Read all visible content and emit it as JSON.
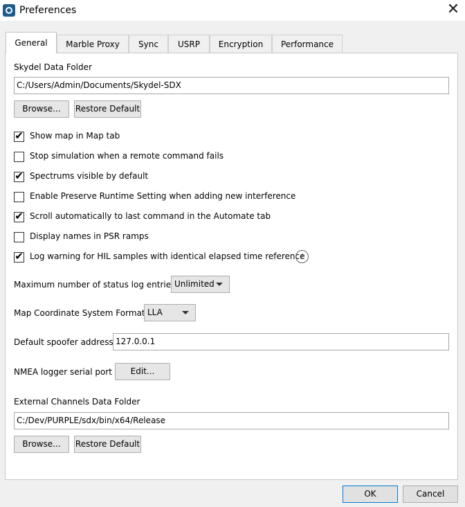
{
  "window": {
    "title": "Preferences",
    "close_symbol": "✕"
  },
  "tabs": [
    {
      "label": "General",
      "active": true
    },
    {
      "label": "Marble Proxy",
      "active": false
    },
    {
      "label": "Sync",
      "active": false
    },
    {
      "label": "USRP",
      "active": false
    },
    {
      "label": "Encryption",
      "active": false
    },
    {
      "label": "Performance",
      "active": false
    }
  ],
  "data_folder": {
    "label": "Skydel Data Folder",
    "value": "C:/Users/Admin/Documents/Skydel-SDX",
    "browse_label": "Browse...",
    "restore_label": "Restore Default"
  },
  "checkboxes": [
    {
      "label": "Show map in Map tab",
      "checked": true,
      "mark": "✔"
    },
    {
      "label": "Stop simulation when a remote command fails",
      "checked": false,
      "mark": ""
    },
    {
      "label": "Spectrums visible by default",
      "checked": true,
      "mark": "✔"
    },
    {
      "label": "Enable Preserve Runtime Setting when adding new interference",
      "checked": false,
      "mark": ""
    },
    {
      "label": "Scroll automatically to last command in the Automate tab",
      "checked": true,
      "mark": "✔"
    },
    {
      "label": "Display names in PSR ramps",
      "checked": false,
      "mark": ""
    },
    {
      "label": "Log warning for HIL samples with identical elapsed time reference",
      "checked": true,
      "mark": "✔"
    }
  ],
  "info_symbol": "i",
  "max_log": {
    "label": "Maximum number of status log entries",
    "value": "Unlimited"
  },
  "coord_format": {
    "label": "Map Coordinate System Format",
    "value": "LLA"
  },
  "spoofer": {
    "label": "Default spoofer address",
    "value": "127.0.0.1"
  },
  "nmea": {
    "label": "NMEA logger serial port",
    "edit_label": "Edit..."
  },
  "ext_folder": {
    "label": "External Channels Data Folder",
    "value": "C:/Dev/PURPLE/sdx/bin/x64/Release",
    "browse_label": "Browse...",
    "restore_label": "Restore Default"
  },
  "footer": {
    "ok_label": "OK",
    "cancel_label": "Cancel"
  },
  "colors": {
    "accent": "#0078d7",
    "panel_bg": "#ffffff",
    "window_bg": "#f0f0f0"
  }
}
